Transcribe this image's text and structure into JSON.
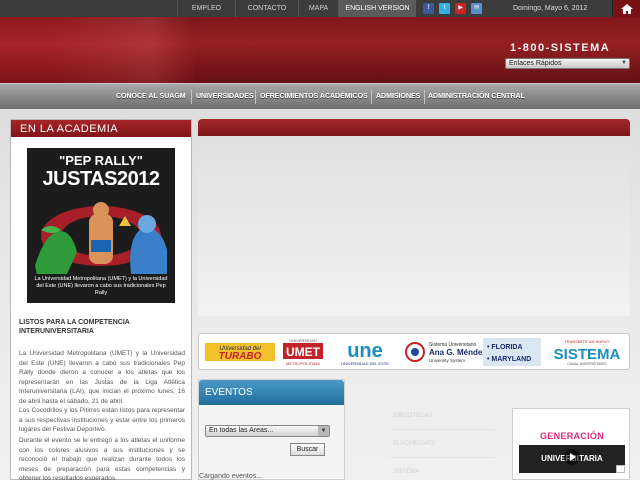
{
  "topbar": {
    "links": [
      "EMPLEO",
      "CONTACTO",
      "MAPA",
      "ENGLISH VERSION"
    ],
    "date": "Domingo, Mayo 6, 2012",
    "social_icons": [
      "facebook-icon",
      "twitter-icon",
      "youtube-icon",
      "mail-icon"
    ],
    "home_icon": "home-icon"
  },
  "header": {
    "phone": "1-800-SISTEMA",
    "quicklinks_value": "Enlaces Rápidos"
  },
  "nav": {
    "items": [
      "CONOCE AL SUAGM",
      "UNIVERSIDADES",
      "OFRECIMIENTOS ACADÉMICOS",
      "ADMISIONES",
      "ADMINISTRACIÓN CENTRAL"
    ]
  },
  "academia": {
    "title": "EN LA ACADEMIA",
    "poster": {
      "top": "\"PEP RALLY\"",
      "main": "JUSTAS2012",
      "caption": "La Universidad Metropolitana (UMET) y la Universidad del Este (UNE) llevaron a cabo sus tradicionales Pep Rally"
    },
    "article_title": "LISTOS PARA LA COMPETENCIA INTERUNIVERSITARIA",
    "paragraphs": [
      "La Universidad Metropolitana (UMET) y la Universidad del Este (UNE) llevaron a cabo sus tradicionales Pep Rally donde dieron a conocer a los atletas que los representarán en las Justas de la Liga Atlética Interuniversitaria (LAI), que inician el próximo lunes, 16 de abril hasta el sábado, 21 de abril.",
      "Los Cocodrilos y los Pitirres están listos para representar a sus respectivas instituciones y estar entre los primeros lugares del Festival Deportivo.",
      "Durante el evento se le entregó a los atletas el uniforme con los colores alusivos a sus instituciones y se reconoció el trabajo que realizan durante todos los meses de preparación para estas competencias y obtener los resultados esperados."
    ]
  },
  "logos": {
    "turabo_line1": "Universidad del",
    "turabo_line2": "TURABO",
    "umet_top": "UNIVERSIDAD",
    "umet_main": "UMET",
    "umet_bottom": "METROPOLITANA",
    "une_main": "une",
    "une_sub": "UNIVERSIDAD DEL ESTE",
    "agm_line1": "Sistema Universitario",
    "agm_line2": "Ana G. Méndez",
    "agm_line3": "University System",
    "florida": "• FLORIDA",
    "maryland": "• MARYLAND",
    "sistema_top": "TRANSMITE UN NUEVO",
    "sistema_main": "SISTEMA",
    "sistema_bottom": "CANAL UNIVERSITARIO"
  },
  "events": {
    "title": "EVENTOS",
    "area_select_value": "En todas las Areas...",
    "search_button": "Buscar",
    "loading": "Cargando eventos..."
  },
  "faded_links": [
    "BIBLIOTECAS",
    "BLACKBOARD",
    "SISTEMA"
  ],
  "banner": {
    "top": "GENERACIÓN",
    "bottom": "UNIVERSITARIA"
  },
  "colors": {
    "brand_red": "#8c1a1e",
    "nav_gray": "#8a8a8a",
    "events_blue": "#2a7aab"
  }
}
